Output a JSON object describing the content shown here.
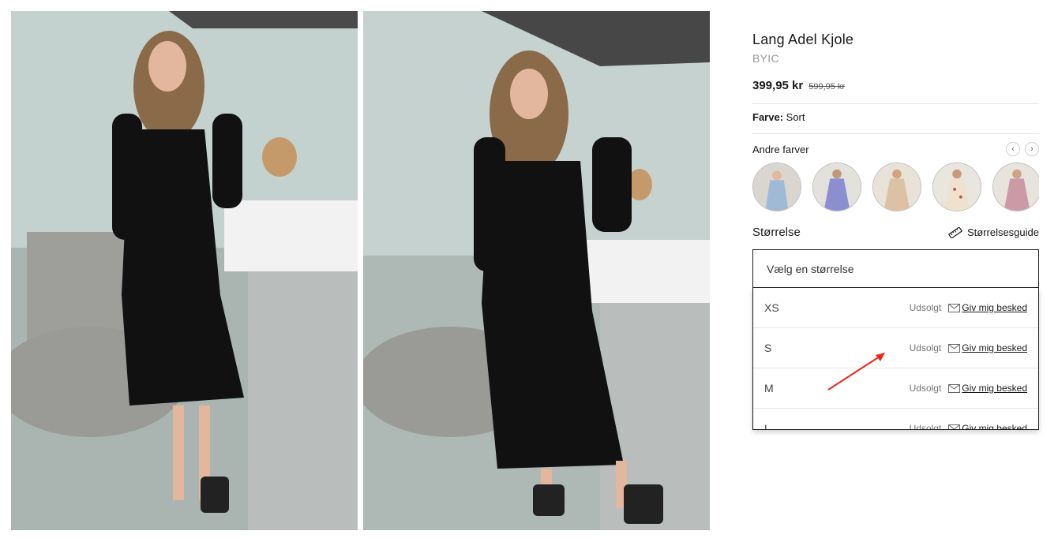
{
  "product": {
    "title": "Lang Adel Kjole",
    "brand": "BYIC",
    "price": "399,95 kr",
    "old_price": "599,95 kr",
    "color_label": "Farve:",
    "color_value": "Sort"
  },
  "other_colors": {
    "label": "Andre farver",
    "prev_icon": "‹",
    "next_icon": "›",
    "swatches": [
      {
        "name": "light-blue-dress",
        "color": "#9fb9d6"
      },
      {
        "name": "purple-floral-dress",
        "color": "#8b8fd0"
      },
      {
        "name": "beige-dress",
        "color": "#dcc1a4"
      },
      {
        "name": "cream-floral-dress",
        "color": "#eee2cf"
      },
      {
        "name": "pink-dress",
        "color": "#cc9aa7"
      }
    ]
  },
  "size": {
    "label": "Størrelse",
    "guide_label": "Størrelsesguide",
    "select_placeholder": "Vælg en størrelse",
    "options": [
      {
        "size": "XS",
        "status": "Udsolgt",
        "notify": "Giv mig besked"
      },
      {
        "size": "S",
        "status": "Udsolgt",
        "notify": "Giv mig besked"
      },
      {
        "size": "M",
        "status": "Udsolgt",
        "notify": "Giv mig besked"
      },
      {
        "size": "L",
        "status": "Udsolgt",
        "notify": "Giv mig besked"
      }
    ]
  },
  "colors": {
    "annotation_arrow": "#e8291c"
  }
}
